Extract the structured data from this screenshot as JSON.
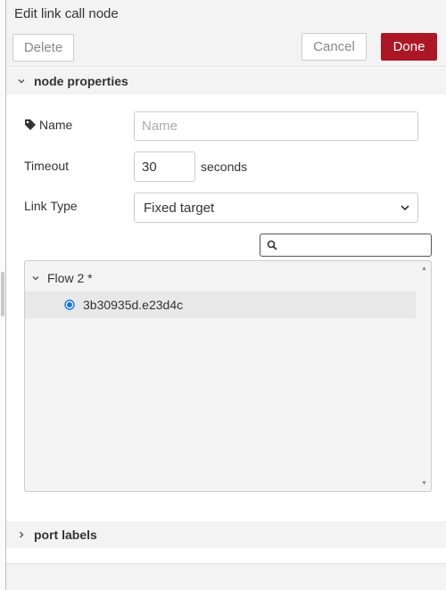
{
  "tray": {
    "title": "Edit link call node",
    "delete_label": "Delete",
    "cancel_label": "Cancel",
    "done_label": "Done"
  },
  "sections": {
    "node_properties": "node properties",
    "port_labels": "port labels"
  },
  "form": {
    "name_label": "Name",
    "name_value": "",
    "name_placeholder": "Name",
    "timeout_label": "Timeout",
    "timeout_value": "30",
    "timeout_unit": "seconds",
    "link_type_label": "Link Type",
    "link_type_selected": "Fixed target"
  },
  "search": {
    "value": "",
    "icon": "search-icon"
  },
  "tree": {
    "flow_label": "Flow 2 *",
    "node_label": "3b30935d.e23d4c",
    "node_selected": true
  },
  "colors": {
    "done": "#ad1625",
    "radio": "#1a73e8",
    "header_bg": "#f3f3f3"
  }
}
